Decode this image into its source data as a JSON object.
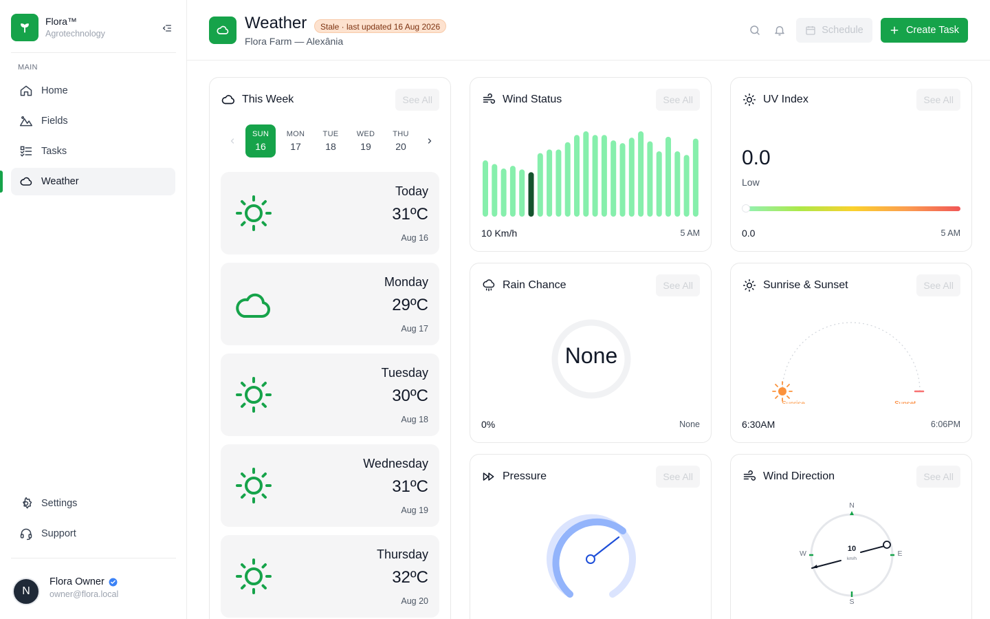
{
  "sidebar": {
    "brand_name": "Flora™",
    "brand_sub": "Agrotechnology",
    "section_label": "MAIN",
    "items": [
      {
        "label": "Home",
        "icon": "home-icon"
      },
      {
        "label": "Fields",
        "icon": "mountain-icon"
      },
      {
        "label": "Tasks",
        "icon": "list-check-icon"
      },
      {
        "label": "Weather",
        "icon": "cloud-icon",
        "active": true
      }
    ],
    "bottom_items": [
      {
        "label": "Settings",
        "icon": "gear-icon"
      },
      {
        "label": "Support",
        "icon": "headset-icon"
      }
    ],
    "user": {
      "initial": "N",
      "name": "Flora Owner",
      "email": "owner@flora.local"
    }
  },
  "header": {
    "title": "Weather",
    "badge": "Stale · last updated 16 Aug 2026",
    "subtitle": "Flora Farm — Alexânia",
    "schedule_label": "Schedule",
    "create_label": "Create Task"
  },
  "colors": {
    "accent": "#16a34a",
    "bar_light": "#86efac",
    "bar_dark": "#14532d",
    "badge_bg": "#fde2cf"
  },
  "see_all_label": "See All",
  "week": {
    "title": "This Week",
    "days": [
      {
        "name": "SUN",
        "num": "16",
        "active": true
      },
      {
        "name": "MON",
        "num": "17"
      },
      {
        "name": "TUE",
        "num": "18"
      },
      {
        "name": "WED",
        "num": "19"
      },
      {
        "name": "THU",
        "num": "20"
      }
    ],
    "forecast": [
      {
        "day": "Today",
        "temp": "31ºC",
        "date": "Aug 16",
        "icon": "sun"
      },
      {
        "day": "Monday",
        "temp": "29ºC",
        "date": "Aug 17",
        "icon": "cloud"
      },
      {
        "day": "Tuesday",
        "temp": "30ºC",
        "date": "Aug 18",
        "icon": "sun"
      },
      {
        "day": "Wednesday",
        "temp": "31ºC",
        "date": "Aug 19",
        "icon": "sun"
      },
      {
        "day": "Thursday",
        "temp": "32ºC",
        "date": "Aug 20",
        "icon": "sun"
      }
    ]
  },
  "wind": {
    "title": "Wind Status",
    "speed": "10 Km/h",
    "time": "5 AM",
    "bars": [
      0.62,
      0.58,
      0.53,
      0.56,
      0.52,
      0.49,
      0.7,
      0.74,
      0.74,
      0.82,
      0.9,
      0.94,
      0.9,
      0.9,
      0.84,
      0.81,
      0.87,
      0.94,
      0.83,
      0.72,
      0.88,
      0.72,
      0.68,
      0.86,
      0.6
    ],
    "highlight_index": 5
  },
  "uv": {
    "title": "UV Index",
    "value": "0.0",
    "level": "Low",
    "foot_value": "0.0",
    "time": "5 AM",
    "position": 0.0
  },
  "rain": {
    "title": "Rain Chance",
    "center": "None",
    "percent": "0%",
    "label": "None"
  },
  "sun": {
    "title": "Sunrise & Sunset",
    "sunrise_label": "Sunrise",
    "sunset_label": "Sunset",
    "sunrise": "6:30AM",
    "sunset": "6:06PM"
  },
  "pressure": {
    "title": "Pressure"
  },
  "direction": {
    "title": "Wind Direction",
    "n": "N",
    "s": "S",
    "e": "E",
    "w": "W",
    "speed": "10",
    "unit": "km/h"
  }
}
